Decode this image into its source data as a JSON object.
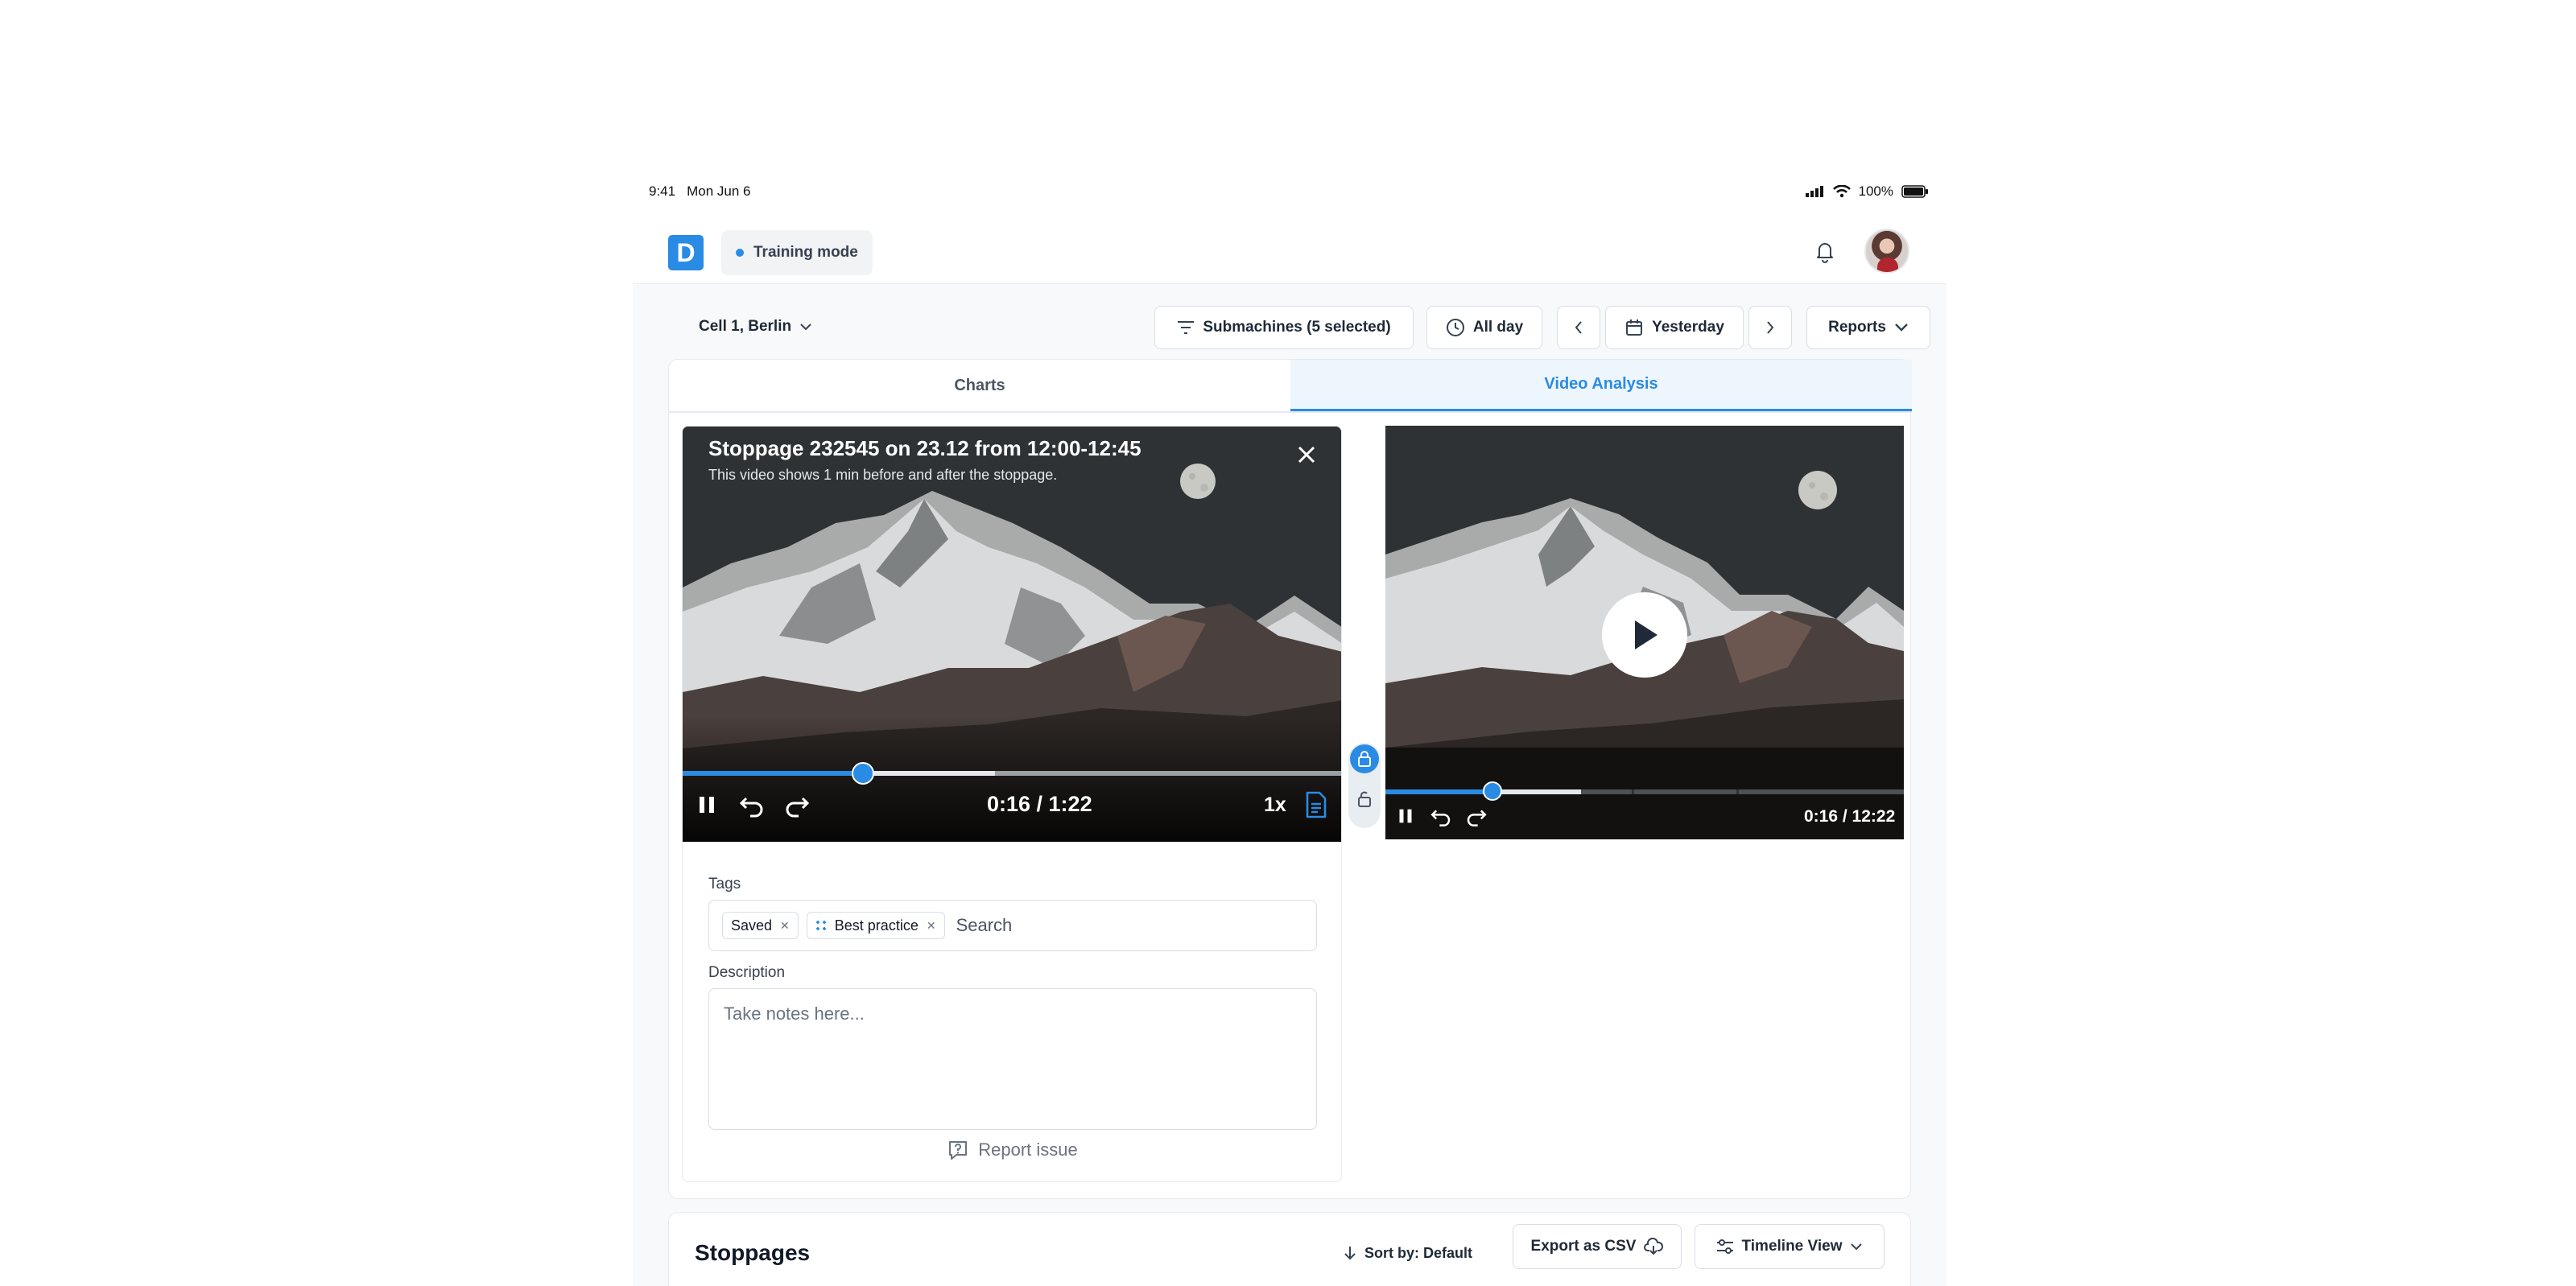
{
  "status_bar": {
    "time": "9:41",
    "date": "Mon Jun 6",
    "battery": "100%"
  },
  "header": {
    "logo_letter": "D",
    "mode_label": "Training mode"
  },
  "filters": {
    "cell": "Cell 1,  Berlin",
    "submachines": "Submachines (5 selected)",
    "time_range": "All day",
    "date": "Yesterday",
    "reports": "Reports"
  },
  "tabs": [
    {
      "label": "Charts",
      "active": false
    },
    {
      "label": "Video Analysis",
      "active": true
    }
  ],
  "video_main": {
    "title": "Stoppage 232545 on 23.12 from 12:00-12:45",
    "subtitle": "This video shows 1 min before and after the stoppage.",
    "time": "0:16 / 1:22",
    "speed": "1x",
    "progress_played": 0.273,
    "progress_buffered": 0.473
  },
  "tags": {
    "label": "Tags",
    "items": [
      "Saved",
      "Best practice"
    ],
    "search_placeholder": "Search"
  },
  "description": {
    "label": "Description",
    "placeholder": "Take notes here..."
  },
  "report_issue": "Report issue",
  "video_secondary": {
    "time": "0:16 / 12:22",
    "progress_played": 0.206,
    "progress_buffered": 0.378
  },
  "stoppages": {
    "title": "Stoppages",
    "sort": "Sort by: Default",
    "export": "Export as CSV",
    "view": "Timeline View"
  },
  "colors": {
    "accent": "#2a8be4",
    "background": "#f8f9fa"
  }
}
